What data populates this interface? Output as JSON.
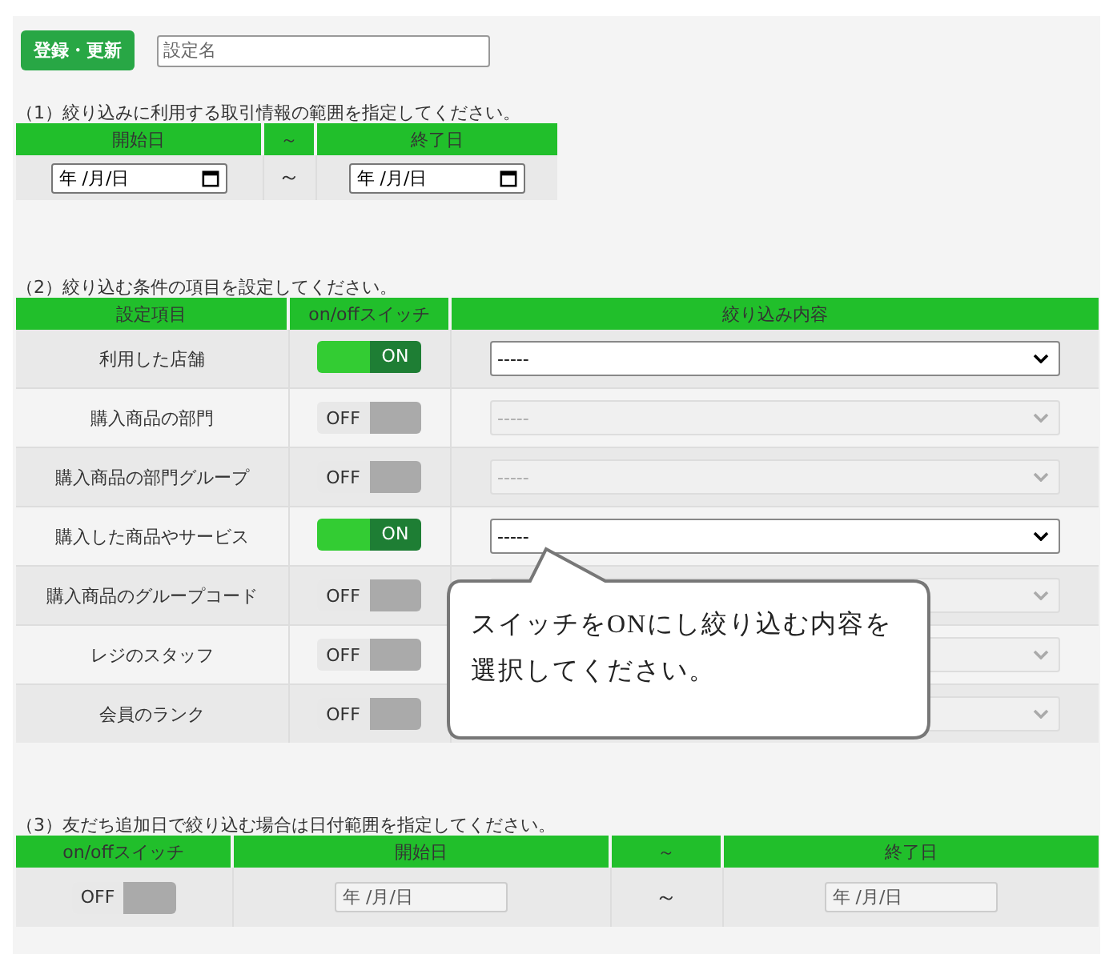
{
  "toolbar": {
    "save_button": "登録・更新",
    "name_field": {
      "placeholder": "設定名"
    }
  },
  "section1": {
    "title": "（1）絞り込みに利用する取引情報の範囲を指定してください。",
    "columns": [
      "開始日",
      "～",
      "終了日"
    ],
    "start": "年 /月/日",
    "separator": "～",
    "end": "年 /月/日"
  },
  "section2": {
    "title": "（2）絞り込む条件の項目を設定してください。",
    "columns": [
      "設定項目",
      "on/offスイッチ",
      "絞り込み内容"
    ],
    "rows": [
      {
        "label": "利用した店舗",
        "switch": {
          "on": true,
          "text": "ON"
        },
        "select": {
          "value": "-----"
        }
      },
      {
        "label": "購入商品の部門",
        "switch": {
          "on": false,
          "text": "OFF"
        },
        "select": {
          "value": "-----"
        }
      },
      {
        "label": "購入商品の部門グループ",
        "switch": {
          "on": false,
          "text": "OFF"
        },
        "select": {
          "value": "-----"
        }
      },
      {
        "label": "購入した商品やサービス",
        "switch": {
          "on": true,
          "text": "ON"
        },
        "select": {
          "value": "-----"
        }
      },
      {
        "label": "購入商品のグループコード",
        "switch": {
          "on": false,
          "text": "OFF"
        },
        "select": {}
      },
      {
        "label": "レジのスタッフ",
        "switch": {
          "on": false,
          "text": "OFF"
        },
        "select": {}
      },
      {
        "label": "会員のランク",
        "switch": {
          "on": false,
          "text": "OFF"
        },
        "select": {}
      }
    ]
  },
  "callout": "スイッチをONにし絞り込む内容を選択してください。",
  "section3": {
    "title": "（3）友だち追加日で絞り込む場合は日付範囲を指定してください。",
    "columns": [
      "on/offスイッチ",
      "開始日",
      "～",
      "終了日"
    ],
    "switch": {
      "on": false,
      "text": "OFF"
    },
    "start": "年 /月/日",
    "separator": "～",
    "end": "年 /月/日"
  }
}
